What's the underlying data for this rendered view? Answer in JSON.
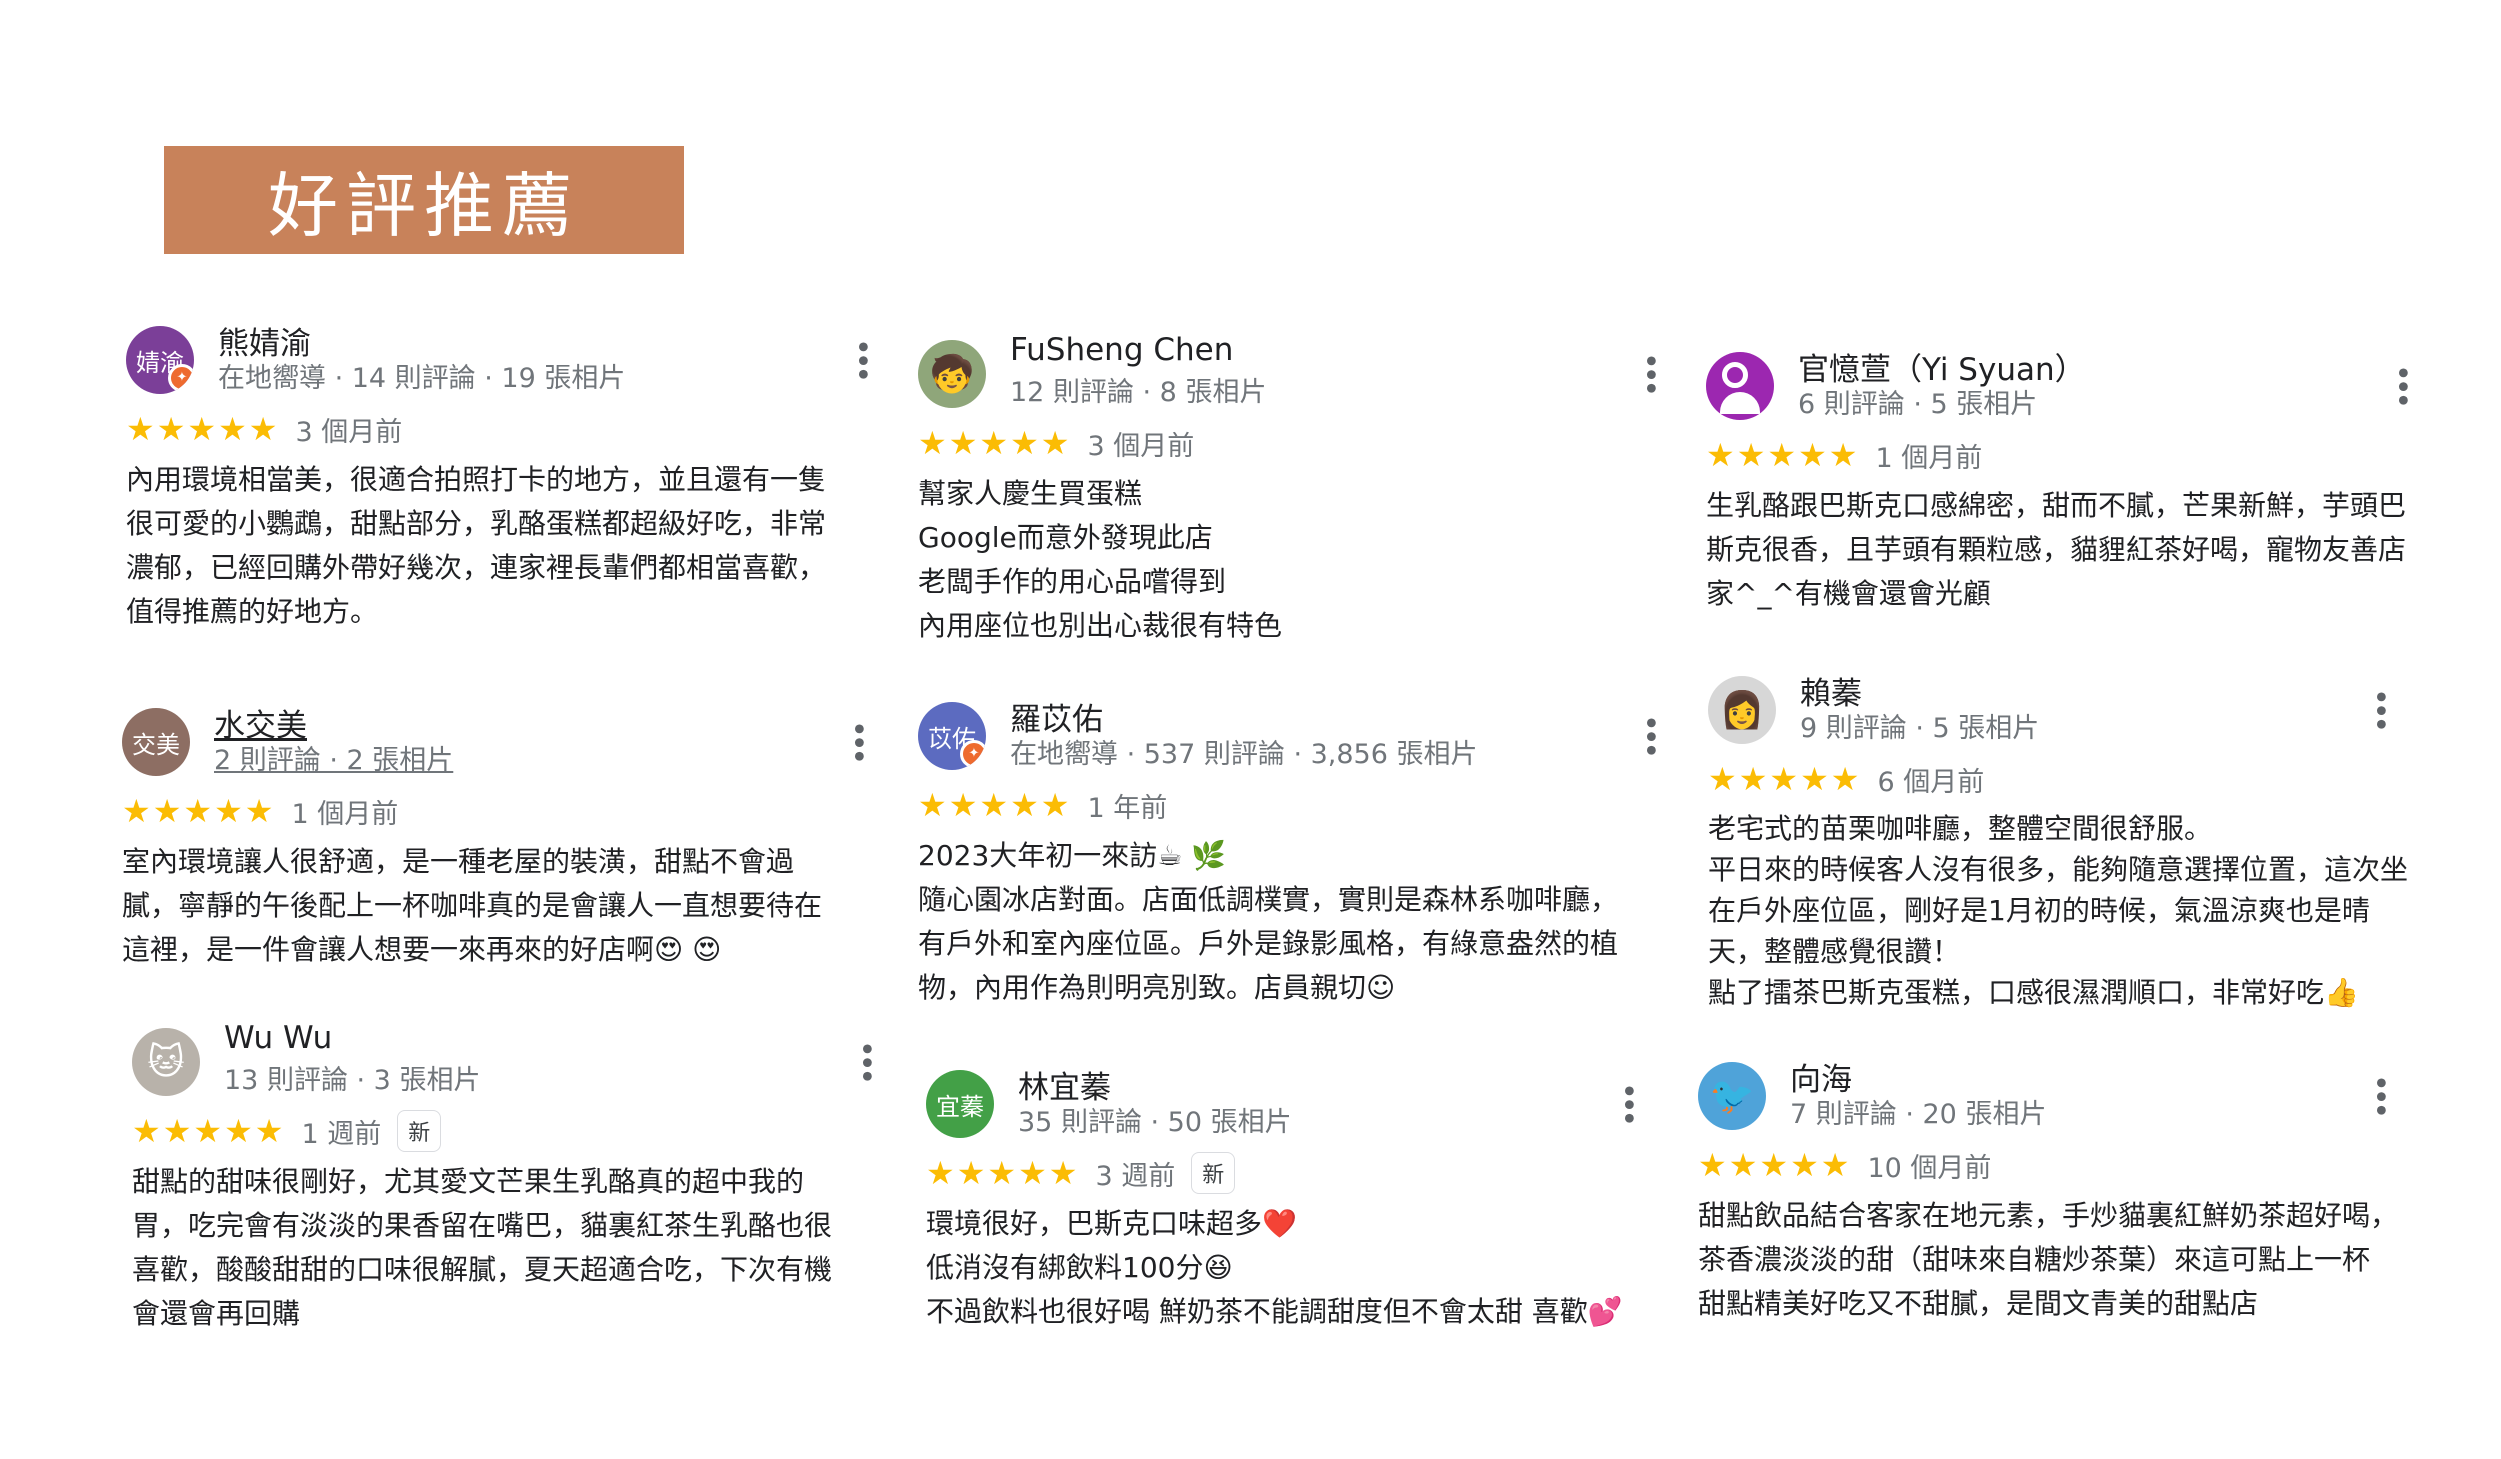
{
  "page_title": "好評推薦",
  "reviews": [
    {
      "name": "熊婧渝",
      "meta": "在地嚮導 · 14 則評論 · 19 張相片",
      "avatar_text": "婧渝",
      "avatar_color": "#7b3f98",
      "stars": "★★★★★",
      "date": "3 個月前",
      "lines": [
        "內用環境相當美，很適合拍照打卡的地方，並且還有一隻",
        "很可愛的小鸚鵡，甜點部分，乳酪蛋糕都超級好吃，非常",
        "濃郁，已經回購外帶好幾次，連家裡長輩們都相當喜歡，",
        "值得推薦的好地方。"
      ]
    },
    {
      "name": "水交美",
      "meta": "2 則評論 · 2 張相片",
      "avatar_text": "交美",
      "avatar_color": "#8d6e63",
      "stars": "★★★★★",
      "date": "1 個月前",
      "lines": [
        "室內環境讓人很舒適，是一種老屋的裝潢，甜點不會過",
        "膩，寧靜的午後配上一杯咖啡真的是會讓人一直想要待在",
        "這裡，是一件會讓人想要一來再來的好店啊😍 😍"
      ]
    },
    {
      "name": "Wu Wu",
      "meta": "13 則評論 · 3 張相片",
      "avatar_icon": "cat-photo",
      "stars": "★★★★★",
      "date": "1 週前",
      "new_label": "新",
      "lines": [
        "甜點的甜味很剛好，尤其愛文芒果生乳酪真的超中我的",
        "胃，吃完會有淡淡的果香留在嘴巴，貓裏紅茶生乳酪也很",
        "喜歡，酸酸甜甜的口味很解膩，夏天超適合吃，下次有機",
        "會還會再回購"
      ]
    },
    {
      "name": "FuSheng Chen",
      "meta": "12 則評論 · 8 張相片",
      "avatar_icon": "child-photo",
      "stars": "★★★★★",
      "date": "3 個月前",
      "lines": [
        "幫家人慶生買蛋糕",
        "Google而意外發現此店",
        "老闆手作的用心品嚐得到",
        "內用座位也別出心裁很有特色"
      ]
    },
    {
      "name": "羅苡佑",
      "meta": "在地嚮導 · 537 則評論 · 3,856 張相片",
      "avatar_text": "苡佑",
      "avatar_color": "#5c6bc0",
      "stars": "★★★★★",
      "date": "1 年前",
      "lines": [
        "2023大年初一來訪☕ 🌿",
        "隨心園冰店對面。店面低調樸實，實則是森林系咖啡廳，",
        "有戶外和室內座位區。戶外是錄影風格，有綠意盎然的植",
        "物，內用作為則明亮別致。店員親切☺"
      ]
    },
    {
      "name": "林宜蓁",
      "meta": "35 則評論 · 50 張相片",
      "avatar_text": "宜蓁",
      "avatar_color": "#43a047",
      "stars": "★★★★★",
      "date": "3 週前",
      "new_label": "新",
      "lines": [
        "環境很好，巴斯克口味超多❤️",
        "低消沒有綁飲料100分😆",
        "不過飲料也很好喝 鮮奶茶不能調甜度但不會太甜 喜歡💕"
      ]
    },
    {
      "name": "官憶萱（Yi Syuan）",
      "meta": "6 則評論 · 5 張相片",
      "avatar_icon": "person-icon",
      "avatar_color": "#9c27b0",
      "stars": "★★★★★",
      "date": "1 個月前",
      "lines": [
        "生乳酪跟巴斯克口感綿密，甜而不膩，芒果新鮮，芋頭巴",
        "斯克很香，且芋頭有顆粒感，貓貍紅茶好喝，寵物友善店",
        "家^_^有機會還會光顧"
      ]
    },
    {
      "name": "賴蓁",
      "meta": "9 則評論 · 5 張相片",
      "avatar_icon": "person-photo",
      "stars": "★★★★★",
      "date": "6 個月前",
      "lines": [
        "老宅式的苗栗咖啡廳，整體空間很舒服。",
        "平日來的時候客人沒有很多，能夠隨意選擇位置，這次坐",
        "在戶外座位區，剛好是1月初的時候，氣溫涼爽也是晴",
        "天，整體感覺很讚！",
        "點了擂茶巴斯克蛋糕，口感很濕潤順口，非常好吃👍"
      ]
    },
    {
      "name": "向海",
      "meta": "7 則評論 · 20 張相片",
      "avatar_icon": "bird-photo",
      "stars": "★★★★★",
      "date": "10 個月前",
      "lines": [
        "甜點飲品結合客家在地元素，手炒貓裏紅鮮奶茶超好喝，",
        "茶香濃淡淡的甜（甜味來自糖炒茶葉）來這可點上一杯",
        "甜點精美好吃又不甜膩，是間文青美的甜點店"
      ]
    }
  ]
}
